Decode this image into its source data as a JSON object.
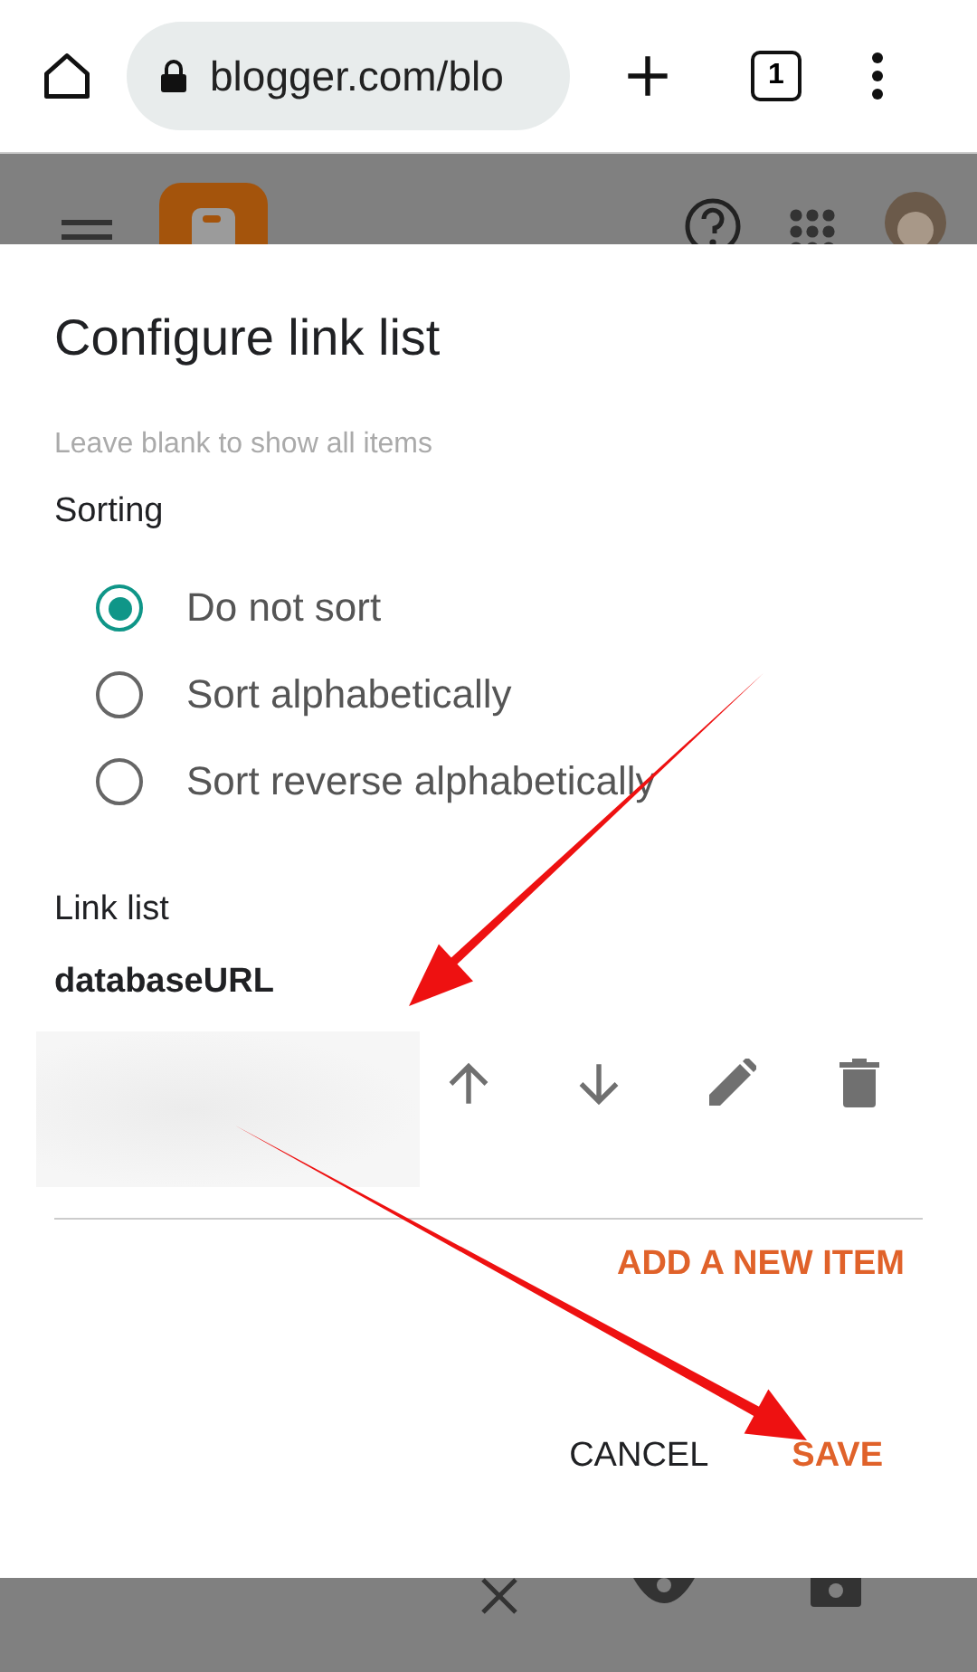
{
  "browser": {
    "url": "blogger.com/blo",
    "tab_count": "1"
  },
  "dialog": {
    "title": "Configure link list",
    "hint": "Leave blank to show all items",
    "sorting_label": "Sorting",
    "sort_options": [
      {
        "label": "Do not sort",
        "selected": true
      },
      {
        "label": "Sort alphabetically",
        "selected": false
      },
      {
        "label": "Sort reverse alphabetically",
        "selected": false
      }
    ],
    "link_list_label": "Link list",
    "link_name": "databaseURL",
    "add_item": "ADD A NEW ITEM",
    "buttons": [
      {
        "label": "CANCEL",
        "kind": "plain"
      },
      {
        "label": "SAVE",
        "kind": "accent"
      }
    ]
  }
}
